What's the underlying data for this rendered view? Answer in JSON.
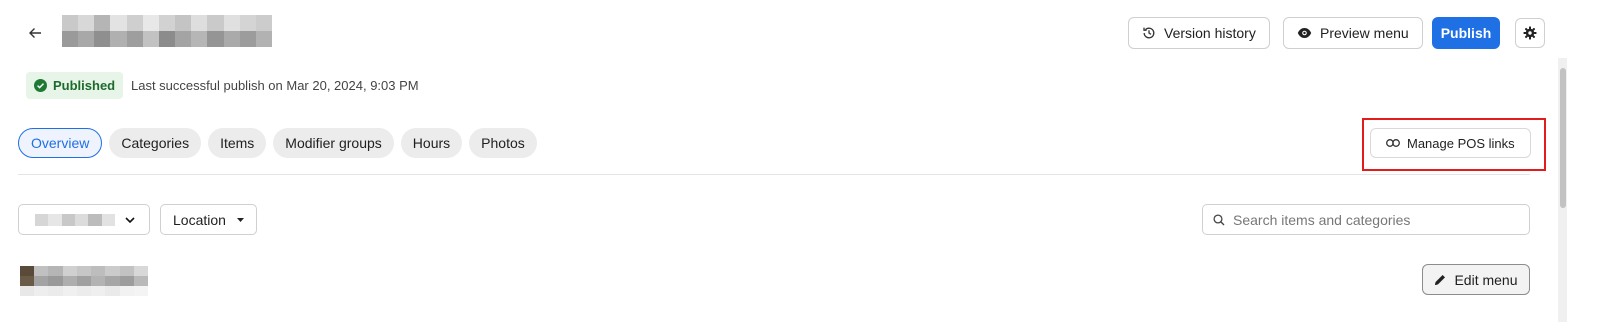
{
  "header": {
    "version_history_label": "Version history",
    "preview_menu_label": "Preview menu",
    "publish_label": "Publish"
  },
  "status": {
    "badge_label": "Published",
    "message": "Last successful publish on Mar 20, 2024, 9:03 PM"
  },
  "tabs": [
    {
      "label": "Overview",
      "active": true
    },
    {
      "label": "Categories",
      "active": false
    },
    {
      "label": "Items",
      "active": false
    },
    {
      "label": "Modifier groups",
      "active": false
    },
    {
      "label": "Hours",
      "active": false
    },
    {
      "label": "Photos",
      "active": false
    }
  ],
  "manage_pos_links_label": "Manage POS links",
  "filters": {
    "location_label": "Location",
    "search_placeholder": "Search items and categories"
  },
  "edit_menu_label": "Edit menu",
  "colors": {
    "accent": "#1f6fe5",
    "published_green": "#1d6b2c",
    "highlight_red": "#e21b1b"
  }
}
